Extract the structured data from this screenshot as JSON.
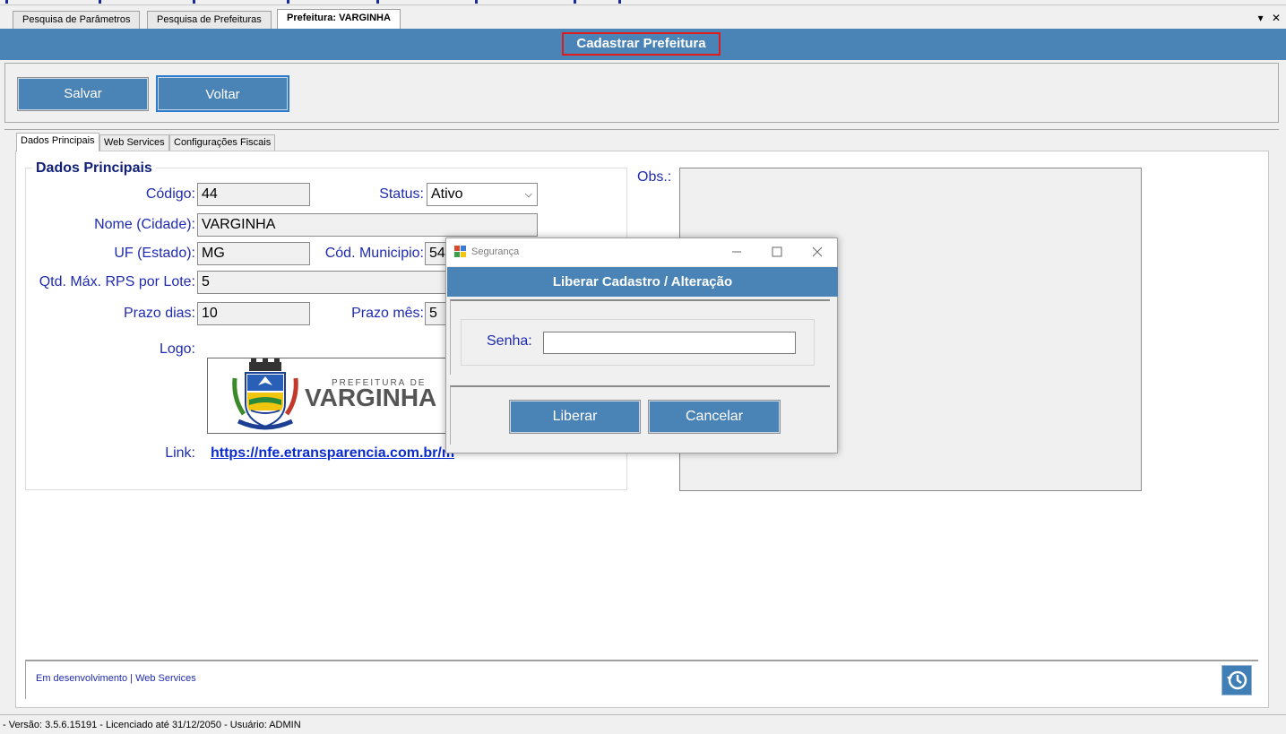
{
  "tabs": [
    {
      "label": "Pesquisa de Parâmetros"
    },
    {
      "label": "Pesquisa de Prefeituras"
    },
    {
      "label": "Prefeitura: VARGINHA"
    }
  ],
  "window_controls": {
    "menu": "▾",
    "close": "✕"
  },
  "header": {
    "title": "Cadastrar Prefeitura"
  },
  "toolbar": {
    "save_label": "Salvar",
    "back_label": "Voltar"
  },
  "inner_tabs": [
    {
      "label": "Dados Principais"
    },
    {
      "label": "Web Services"
    },
    {
      "label": "Configurações Fiscais"
    }
  ],
  "form": {
    "group_title": "Dados Principais",
    "codigo_label": "Código:",
    "codigo_value": "44",
    "status_label": "Status:",
    "status_value": "Ativo",
    "nome_label": "Nome (Cidade):",
    "nome_value": "VARGINHA",
    "uf_label": "UF (Estado):",
    "uf_value": "MG",
    "cod_municipio_label": "Cód. Municipio:",
    "cod_municipio_value": "54",
    "qtd_label": "Qtd. Máx. RPS por Lote:",
    "qtd_value": "5",
    "prazo_dias_label": "Prazo dias:",
    "prazo_dias_value": "10",
    "prazo_mes_label": "Prazo mês:",
    "prazo_mes_value": "5",
    "logo_label": "Logo:",
    "logo_small_text": "PREFEITURA DE",
    "logo_big_text": "VARGINHA",
    "link_label": "Link:",
    "link_value": "https://nfe.etransparencia.com.br/m",
    "obs_label": "Obs.:"
  },
  "footer": {
    "text": "Em desenvolvimento | Web Services"
  },
  "statusbar": {
    "text": "- Versão: 3.5.6.15191 - Licenciado até 31/12/2050 - Usuário: ADMIN"
  },
  "dialog": {
    "window_title": "Segurança",
    "header": "Liberar Cadastro / Alteração",
    "senha_label": "Senha:",
    "senha_value": "",
    "liberar_label": "Liberar",
    "cancelar_label": "Cancelar"
  },
  "colors": {
    "accent": "#4a83b6",
    "label_blue": "#1f2bb0",
    "highlight_red": "#e01b1b"
  }
}
